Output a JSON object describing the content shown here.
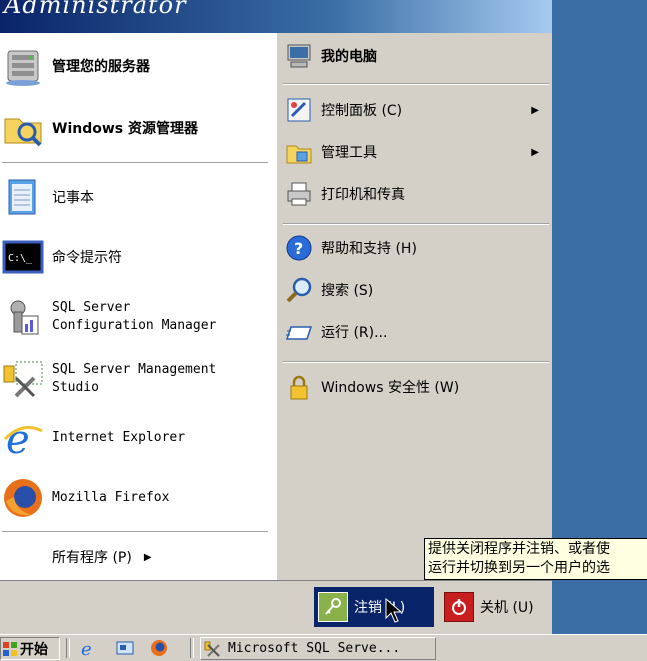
{
  "header": {
    "username": "Administrator"
  },
  "left_items": [
    {
      "label": "管理您的服务器",
      "icon": "server-icon"
    },
    {
      "label": "Windows 资源管理器",
      "icon": "explorer-folder-icon"
    },
    {
      "label": "记事本",
      "icon": "notepad-icon"
    },
    {
      "label": "命令提示符",
      "icon": "cmd-icon"
    },
    {
      "label": "SQL Server\nConfiguration Manager",
      "icon": "sql-config-icon"
    },
    {
      "label": "SQL Server Management\nStudio",
      "icon": "sql-studio-icon"
    },
    {
      "label": "Internet Explorer",
      "icon": "ie-icon"
    },
    {
      "label": "Mozilla Firefox",
      "icon": "firefox-icon"
    }
  ],
  "all_programs": {
    "label": "所有程序 (P)",
    "arrow": "▶"
  },
  "right_items": [
    {
      "label": "我的电脑",
      "icon": "computer-icon"
    },
    {
      "label": "控制面板 (C)",
      "icon": "control-panel-icon",
      "arrow": "▶"
    },
    {
      "label": "管理工具",
      "icon": "admin-tools-icon",
      "arrow": "▶"
    },
    {
      "label": "打印机和传真",
      "icon": "printer-icon"
    },
    {
      "label": "帮助和支持 (H)",
      "icon": "help-icon"
    },
    {
      "label": "搜索 (S)",
      "icon": "search-icon"
    },
    {
      "label": "运行 (R)...",
      "icon": "run-icon"
    },
    {
      "label": "Windows 安全性 (W)",
      "icon": "lock-icon"
    }
  ],
  "bottom": {
    "logoff": "注销 (L)",
    "shutdown": "关机 (U)"
  },
  "tooltip": {
    "line1": "提供关闭程序并注销、或者使",
    "line2": "运行并切换到另一个用户的选"
  },
  "taskbar": {
    "start": "开始",
    "task": "Microsoft SQL Serve..."
  },
  "colors": {
    "header_dark": "#0a246a",
    "desktop": "#3a6ea5",
    "panel": "#d4d0c8",
    "tooltip": "#ffffe1"
  }
}
